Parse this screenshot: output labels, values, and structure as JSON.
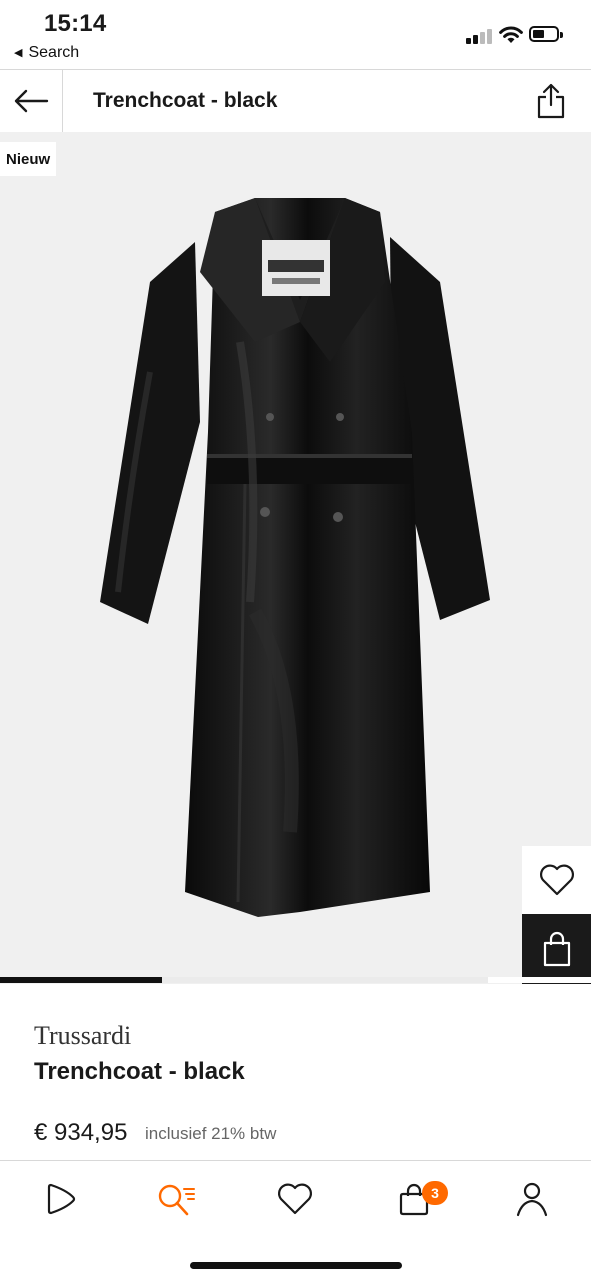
{
  "status_bar": {
    "time": "15:14",
    "back_app": "Search",
    "back_glyph": "◀"
  },
  "header": {
    "title": "Trenchcoat - black",
    "back_icon": "arrow-left-icon",
    "share_icon": "share-icon"
  },
  "gallery": {
    "badge": "Nieuw",
    "image_description_icon": "trenchcoat-image",
    "favorite_icon": "heart-icon",
    "add_to_bag_icon": "shopping-bag-icon",
    "current_image": 1,
    "colors": {
      "active": "#111111",
      "inactive": "#ebebeb"
    }
  },
  "product": {
    "brand": "Trussardi",
    "name": "Trenchcoat - black",
    "price": "€ 934,95",
    "vat": "inclusief 21% btw"
  },
  "tabbar": {
    "items": [
      {
        "name": "home",
        "icon": "play-home-icon",
        "active": false
      },
      {
        "name": "search",
        "icon": "search-list-icon",
        "active": true
      },
      {
        "name": "wishlist",
        "icon": "heart-icon",
        "active": false
      },
      {
        "name": "cart",
        "icon": "bag-icon",
        "active": false,
        "badge": "3"
      },
      {
        "name": "account",
        "icon": "person-icon",
        "active": false
      }
    ],
    "accent": "#ff6900"
  }
}
